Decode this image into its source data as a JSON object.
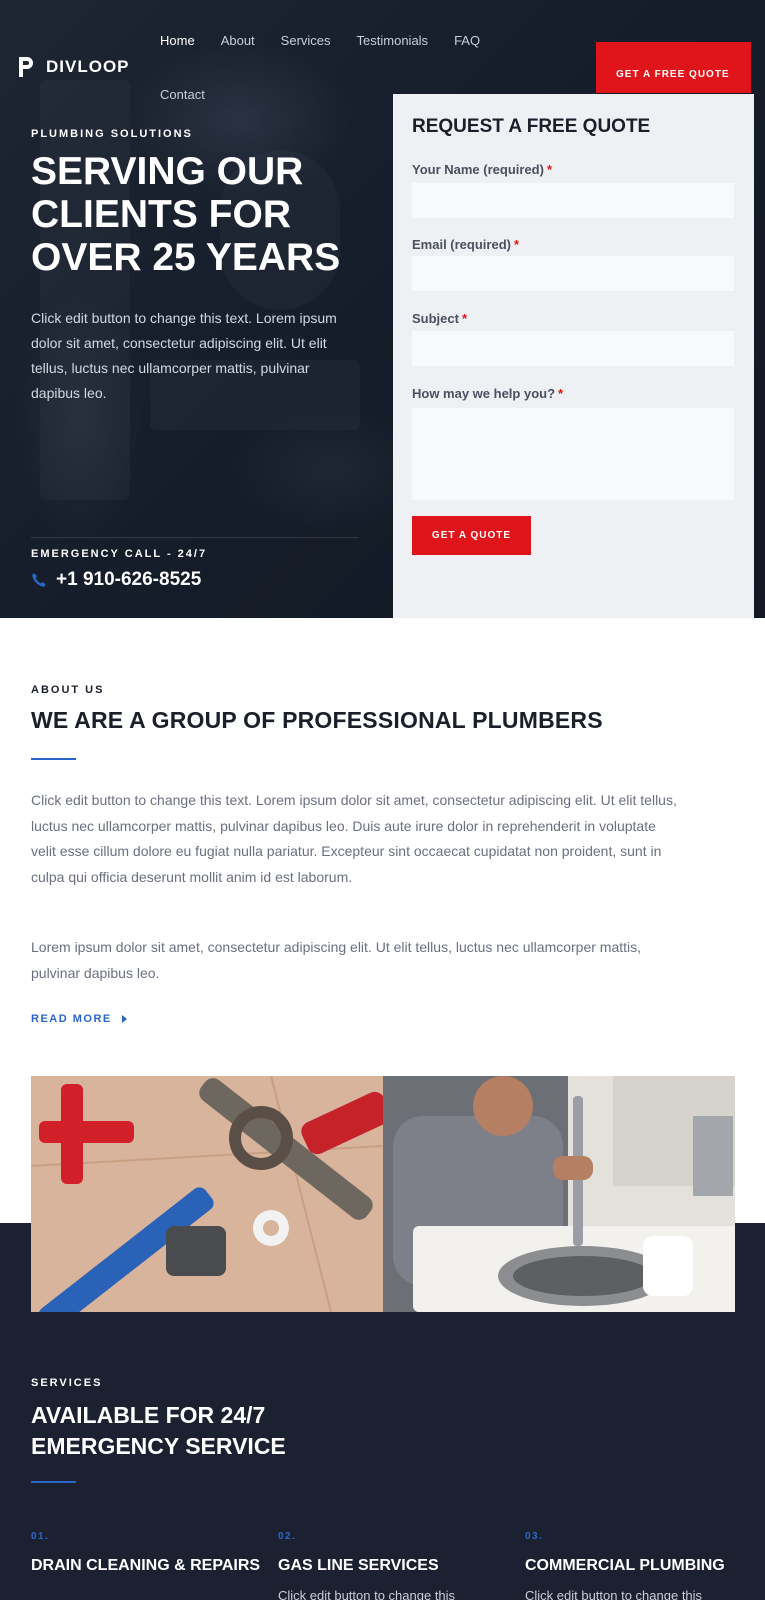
{
  "brand": {
    "name": "DIVLOOP"
  },
  "nav": {
    "items": [
      "Home",
      "About",
      "Services",
      "Testimonials",
      "FAQ",
      "Contact"
    ],
    "cta_label": "GET A FREE QUOTE"
  },
  "hero": {
    "kicker": "PLUMBING SOLUTIONS",
    "title": "SERVING OUR CLIENTS FOR OVER 25 YEARS",
    "text": "Click edit button to change this text. Lorem ipsum dolor sit amet, consectetur adipiscing elit. Ut elit tellus, luctus nec ullamcorper mattis, pulvinar dapibus leo.",
    "emergency_label": "EMERGENCY CALL - 24/7",
    "phone": "+1 910-626-8525"
  },
  "quote_form": {
    "title": "REQUEST A FREE QUOTE",
    "fields": [
      {
        "label": "Your Name (required)",
        "required_mark": "*",
        "value": ""
      },
      {
        "label": "Email (required)",
        "required_mark": "*",
        "value": ""
      },
      {
        "label": "Subject",
        "required_mark": "*",
        "value": ""
      },
      {
        "label": "How may we help you?",
        "required_mark": "*",
        "value": ""
      }
    ],
    "submit_label": "GET A QUOTE"
  },
  "about": {
    "kicker": "ABOUT US",
    "title": "WE ARE A GROUP OF PROFESSIONAL PLUMBERS",
    "paragraphs": [
      "Click edit button to change this text. Lorem ipsum dolor sit amet, consectetur adipiscing elit. Ut elit tellus, luctus nec ullamcorper mattis, pulvinar dapibus leo. Duis aute irure dolor in reprehenderit in voluptate velit esse cillum dolore eu fugiat nulla pariatur. Excepteur sint occaecat cupidatat non proident, sunt in culpa qui officia deserunt mollit anim id est laborum.",
      "Lorem ipsum dolor sit amet, consectetur adipiscing elit. Ut elit tellus, luctus nec ullamcorper mattis, pulvinar dapibus leo."
    ],
    "read_more": "READ MORE"
  },
  "services": {
    "kicker": "SERVICES",
    "title": "AVAILABLE FOR 24/7 EMERGENCY SERVICE",
    "items": [
      {
        "number": "01.",
        "name": "DRAIN CLEANING & REPAIRS",
        "text": ""
      },
      {
        "number": "02.",
        "name": "GAS LINE SERVICES",
        "text": "Click edit button to change this"
      },
      {
        "number": "03.",
        "name": "COMMERCIAL PLUMBING",
        "text": "Click edit button to change this"
      }
    ]
  },
  "colors": {
    "accent_red": "#e0151b",
    "accent_blue": "#2a66c9",
    "dark_navy": "#1b2130"
  },
  "icons": {
    "logo": "divloop-logo-icon",
    "phone": "phone-icon",
    "read_more_arrow": "caret-right-icon"
  }
}
